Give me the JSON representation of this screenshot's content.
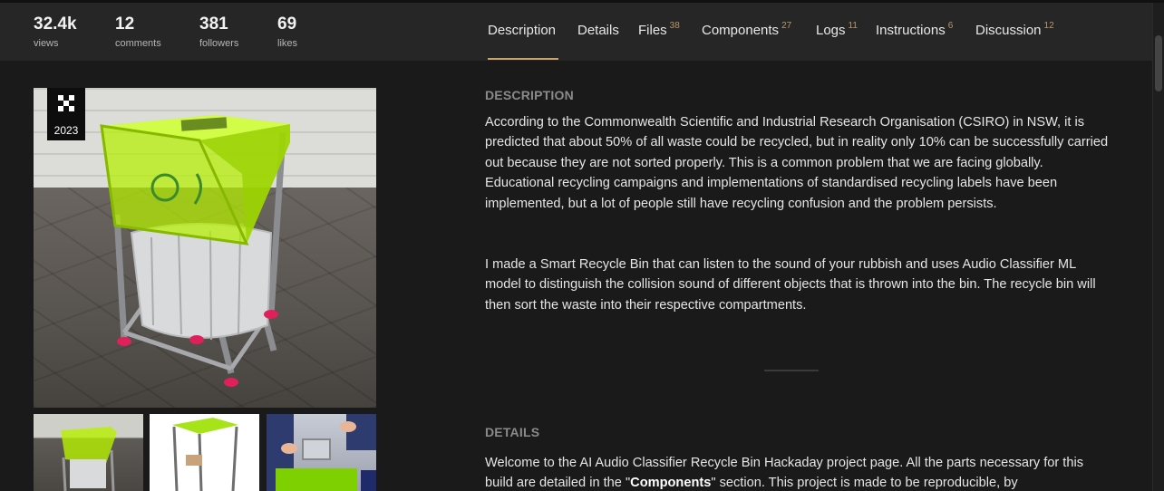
{
  "stats": [
    {
      "value": "32.4k",
      "label": "views"
    },
    {
      "value": "12",
      "label": "comments"
    },
    {
      "value": "381",
      "label": "followers"
    },
    {
      "value": "69",
      "label": "likes"
    }
  ],
  "tabs": [
    {
      "label": "Description",
      "count": ""
    },
    {
      "label": "Details",
      "count": ""
    },
    {
      "label": "Files",
      "count": "38"
    },
    {
      "label": "Components",
      "count": "27"
    },
    {
      "label": "Logs",
      "count": "11"
    },
    {
      "label": "Instructions",
      "count": "6"
    },
    {
      "label": "Discussion",
      "count": "12"
    }
  ],
  "active_tab": "Description",
  "gallery": {
    "badge_year": "2023"
  },
  "description": {
    "title": "DESCRIPTION",
    "paragraph1": "According to the Commonwealth Scientific and Industrial Research Organisation (CSIRO) in NSW, it is predicted that about 50% of all waste could be recycled, but in reality only 10% can be successfully carried out because they are not sorted properly. This is a common problem that we are facing globally. Educational recycling campaigns and implementations of standardised recycling labels have been implemented, but a lot of people still have recycling confusion and the problem persists.",
    "paragraph2": "I made a Smart Recycle Bin that can listen to the sound of your rubbish and uses Audio Classifier ML model to distinguish the collision sound of different objects that is thrown into the bin. The recycle bin will then sort the waste into their respective compartments."
  },
  "details": {
    "title": "DETAILS",
    "text_before": "Welcome to the AI Audio Classifier Recycle Bin Hackaday project page. All the parts necessary for this build are detailed in the \"",
    "bold": "Components",
    "text_after": "\" section. This project is made to be reproducible, by"
  },
  "colors": {
    "accent": "#c9a46c",
    "background": "#1a1a1a",
    "topbar": "#262626",
    "acrylic_green": "#b8f000"
  }
}
